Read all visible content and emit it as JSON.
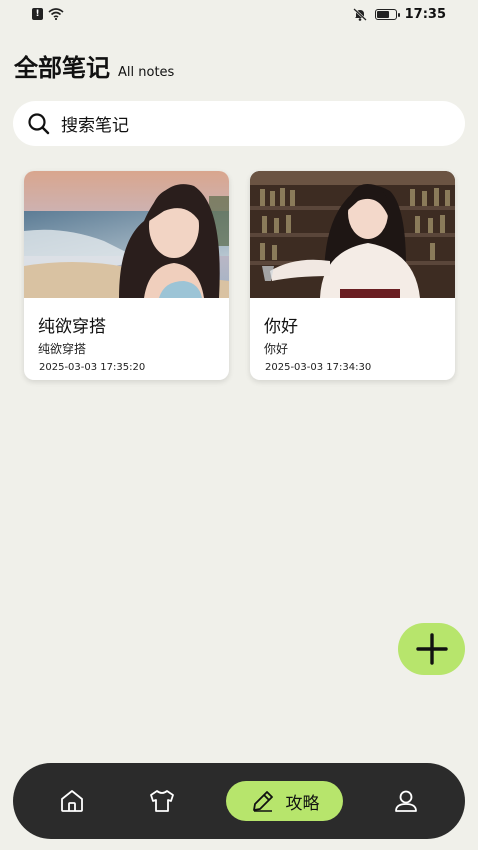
{
  "status_bar": {
    "time": "17:35",
    "sim_label": "!"
  },
  "header": {
    "title": "全部笔记",
    "subtitle": "All notes"
  },
  "search": {
    "placeholder": "搜索笔记"
  },
  "notes": [
    {
      "title": "纯欲穿搭",
      "description": "纯欲穿搭",
      "timestamp": "2025-03-03 17:35:20"
    },
    {
      "title": "你好",
      "description": "你好",
      "timestamp": "2025-03-03 17:34:30"
    }
  ],
  "bottom_nav": {
    "items": [
      {
        "icon": "home-icon"
      },
      {
        "icon": "shirt-icon"
      },
      {
        "icon": "pencil-icon",
        "label": "攻略",
        "active": true
      },
      {
        "icon": "user-icon"
      }
    ]
  },
  "colors": {
    "background": "#f0f0ea",
    "accent": "#b7e56c",
    "nav_bar": "#2b2b2b"
  }
}
